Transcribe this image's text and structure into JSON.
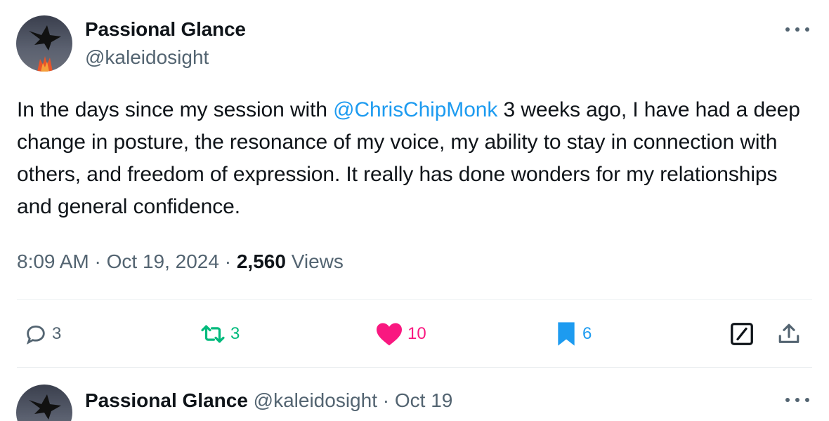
{
  "tweet": {
    "author_name": "Passional Glance",
    "author_handle": "@kaleidosight",
    "text_before": "In the days since my session with ",
    "mention": "@ChrisChipMonk",
    "text_after": " 3 weeks ago, I have had a deep change in posture, the resonance of my voice, my ability to stay in connection with others, and freedom of expression. It really has done wonders for my relationships and general confidence.",
    "time": "8:09 AM",
    "date": "Oct 19, 2024",
    "separator": " · ",
    "views_count": "2,560",
    "views_label": "Views"
  },
  "actions": {
    "replies": "3",
    "retweets": "3",
    "likes": "10",
    "bookmarks": "6"
  },
  "reply": {
    "author_name": "Passional Glance",
    "author_handle": "@kaleidosight",
    "separator": " · ",
    "date": "Oct 19"
  },
  "colors": {
    "accent": "#1d9bf0",
    "retweet": "#00ba7c",
    "like": "#f91880",
    "muted": "#536471"
  },
  "icons": [
    "reply-icon",
    "retweet-icon",
    "heart-icon",
    "bookmark-icon",
    "grok-icon",
    "share-icon",
    "more-icon"
  ]
}
